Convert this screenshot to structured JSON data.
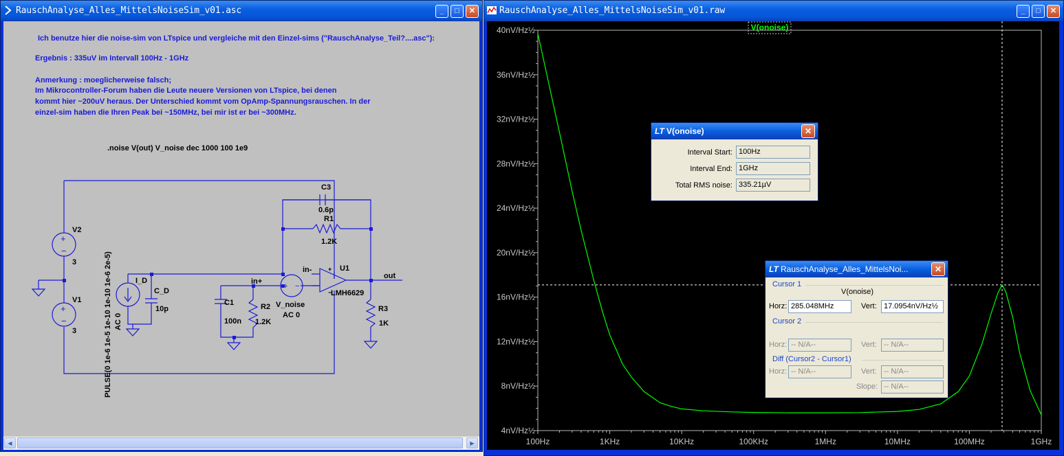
{
  "schematic_window": {
    "title": "RauschAnalyse_Alles_MittelsNoiseSim_v01.asc",
    "notes": {
      "line1": "Ich benutze hier die noise-sim von LTspice und vergleiche mit den Einzel-sims (\"RauschAnalyse_Teil?....asc\"):",
      "line2": "Ergebnis : 335uV im Intervall 100Hz - 1GHz",
      "line3": "Anmerkung : moeglicherweise falsch;",
      "line4": "Im Mikrocontroller-Forum haben die Leute neuere Versionen von LTspice, bei denen",
      "line5": "kommt hier ~200uV heraus. Der Unterschied kommt vom OpAmp-Spannungsrauschen. In der",
      "line6": "einzel-sim haben die Ihren Peak bei ~150MHz, bei mir ist er bei ~300MHz."
    },
    "directive": ".noise V(out) V_noise dec 1000 100 1e9",
    "components": {
      "v2_name": "V2",
      "v2_value": "3",
      "v1_name": "V1",
      "v1_value": "3",
      "c3_name": "C3",
      "c3_value": "0.6p",
      "r1_name": "R1",
      "r1_value": "1.2K",
      "id_name": "I_D",
      "cd_name": "C_D",
      "cd_value": "10p",
      "c1_name": "C1",
      "c1_value": "100n",
      "r2_name": "R2",
      "r2_value": "1.2K",
      "vnoise_name": "V_noise",
      "vnoise_value": "AC 0",
      "u1_name": "U1",
      "u1_model": "LMH6629",
      "r3_name": "R3",
      "r3_value": "1K",
      "inm": "in-",
      "inp": "in+",
      "out": "out",
      "plus": "+",
      "minus": "−",
      "id_pulse": "PULSE(0 1e-6 1e-5 1e-10 1e-10 1e-6 2e-5)",
      "id_ac": "AC 0"
    }
  },
  "waveform_window": {
    "title": "RauschAnalyse_Alles_MittelsNoiseSim_v01.raw"
  },
  "chart_data": {
    "type": "line",
    "title": "V(onoise)",
    "x_scale": "log",
    "xlim": [
      100,
      1000000000
    ],
    "ylim": [
      4,
      40
    ],
    "y_unit": "nV/Hz½",
    "x_ticks": [
      "100Hz",
      "1KHz",
      "10KHz",
      "100KHz",
      "1MHz",
      "10MHz",
      "100MHz",
      "1GHz"
    ],
    "y_ticks": [
      "40nV/Hz½",
      "36nV/Hz½",
      "32nV/Hz½",
      "28nV/Hz½",
      "24nV/Hz½",
      "20nV/Hz½",
      "16nV/Hz½",
      "12nV/Hz½",
      "8nV/Hz½",
      "4nV/Hz½"
    ],
    "grid": false,
    "line_color": "#00ff00",
    "series": [
      {
        "name": "V(onoise)",
        "x": [
          100,
          150,
          200,
          300,
          400,
          600,
          800,
          1000,
          1500,
          2000,
          3000,
          5000,
          7000,
          10000,
          20000,
          50000,
          100000,
          300000,
          1000000,
          3000000,
          10000000,
          20000000,
          40000000,
          70000000,
          100000000,
          150000000,
          200000000,
          250000000,
          285000000,
          320000000,
          400000000,
          500000000,
          700000000,
          1000000000
        ],
        "y": [
          39.7,
          34.5,
          30.8,
          25.5,
          22.0,
          17.5,
          14.6,
          12.6,
          10.0,
          8.8,
          7.5,
          6.5,
          6.2,
          5.95,
          5.78,
          5.68,
          5.63,
          5.6,
          5.6,
          5.62,
          5.72,
          5.9,
          6.4,
          7.5,
          8.9,
          11.8,
          14.5,
          16.4,
          17.1,
          16.5,
          14.2,
          11.0,
          7.6,
          5.4
        ]
      }
    ],
    "cursor1": {
      "x": 285048000,
      "y": 17.0954
    }
  },
  "rms_dialog": {
    "title": "V(onoise)",
    "start_label": "Interval Start:",
    "start_value": "100Hz",
    "end_label": "Interval End:",
    "end_value": "1GHz",
    "rms_label": "Total RMS noise:",
    "rms_value": "335.21µV"
  },
  "cursor_dialog": {
    "title": "RauschAnalyse_Alles_MittelsNoi...",
    "cursor1_label": "Cursor 1",
    "trace_name": "V(onoise)",
    "horz_label": "Horz:",
    "horz_value": "285.048MHz",
    "vert_label": "Vert:",
    "vert_value": "17.0954nV/Hz½",
    "cursor2_label": "Cursor 2",
    "c2_horz_value": "-- N/A--",
    "c2_vert_value": "-- N/A--",
    "diff_label": "Diff (Cursor2 - Cursor1)",
    "diff_horz_value": "-- N/A--",
    "diff_vert_value": "-- N/A--",
    "slope_label": "Slope:",
    "slope_value": "-- N/A--"
  }
}
